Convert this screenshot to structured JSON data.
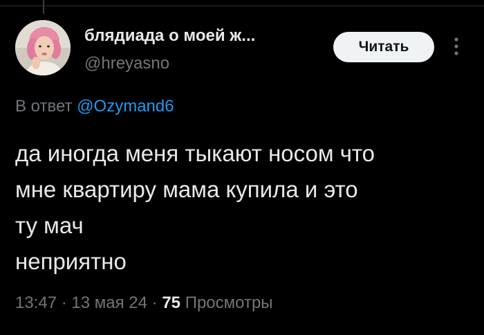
{
  "author": {
    "display_name": "блядиада о моей ж...",
    "handle": "@hreyasno"
  },
  "follow_button": {
    "label": "Читать"
  },
  "more_button": {
    "icon": "more-vertical-icon"
  },
  "reply": {
    "prefix": "В ответ",
    "mention": "@Ozymand6"
  },
  "tweet": {
    "lines": [
      "да иногда меня тыкают носом что",
      "мне квартиру мама купила и это",
      "ту мач",
      "неприятно"
    ]
  },
  "meta": {
    "time": "13:47",
    "separator": "·",
    "date": "13 мая 24",
    "views_count": "75",
    "views_label": "Просмотры"
  },
  "colors": {
    "background": "#000000",
    "text_primary": "#e7e9ea",
    "text_secondary": "#71767b",
    "accent": "#1d9bf0",
    "button_bg": "#eff3f4"
  }
}
